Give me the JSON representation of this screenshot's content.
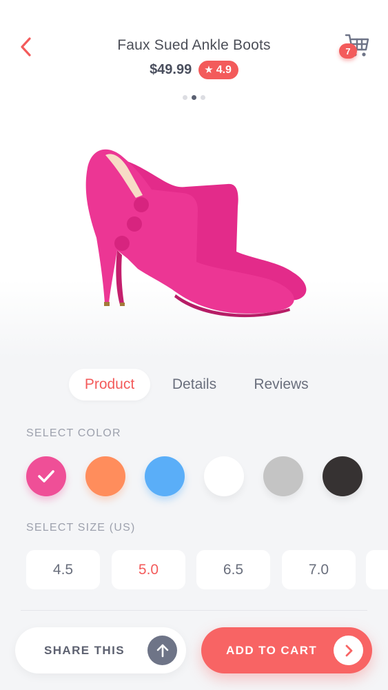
{
  "header": {
    "title": "Faux Sued Ankle Boots",
    "price": "$49.99",
    "rating": "4.9",
    "rating_icon": "star-icon",
    "back_icon": "chevron-left-icon",
    "cart_icon": "shopping-cart-icon",
    "cart_count": "7"
  },
  "carousel": {
    "total": 3,
    "active_index": 1
  },
  "product_image": {
    "subject": "pink suede high-heel ankle boots"
  },
  "tabs": [
    {
      "label": "Product",
      "active": true
    },
    {
      "label": "Details",
      "active": false
    },
    {
      "label": "Reviews",
      "active": false
    }
  ],
  "color_section": {
    "label": "SELECT COLOR",
    "colors": [
      "#ef4f97",
      "#ff8d5c",
      "#5aaef8",
      "#ffffff",
      "#c4c4c4",
      "#363232"
    ],
    "selected_index": 0
  },
  "size_section": {
    "label": "SELECT SIZE (US)",
    "sizes": [
      "4.5",
      "5.0",
      "6.5",
      "7.0"
    ],
    "selected": "5.0"
  },
  "actions": {
    "share_label": "SHARE THIS",
    "share_icon": "arrow-up-icon",
    "add_to_cart_label": "ADD TO CART",
    "add_to_cart_icon": "chevron-right-icon"
  },
  "colors": {
    "accent": "#f35b5b",
    "text": "#4c4f58",
    "muted": "#9da1ad",
    "background": "#f4f5f7"
  }
}
